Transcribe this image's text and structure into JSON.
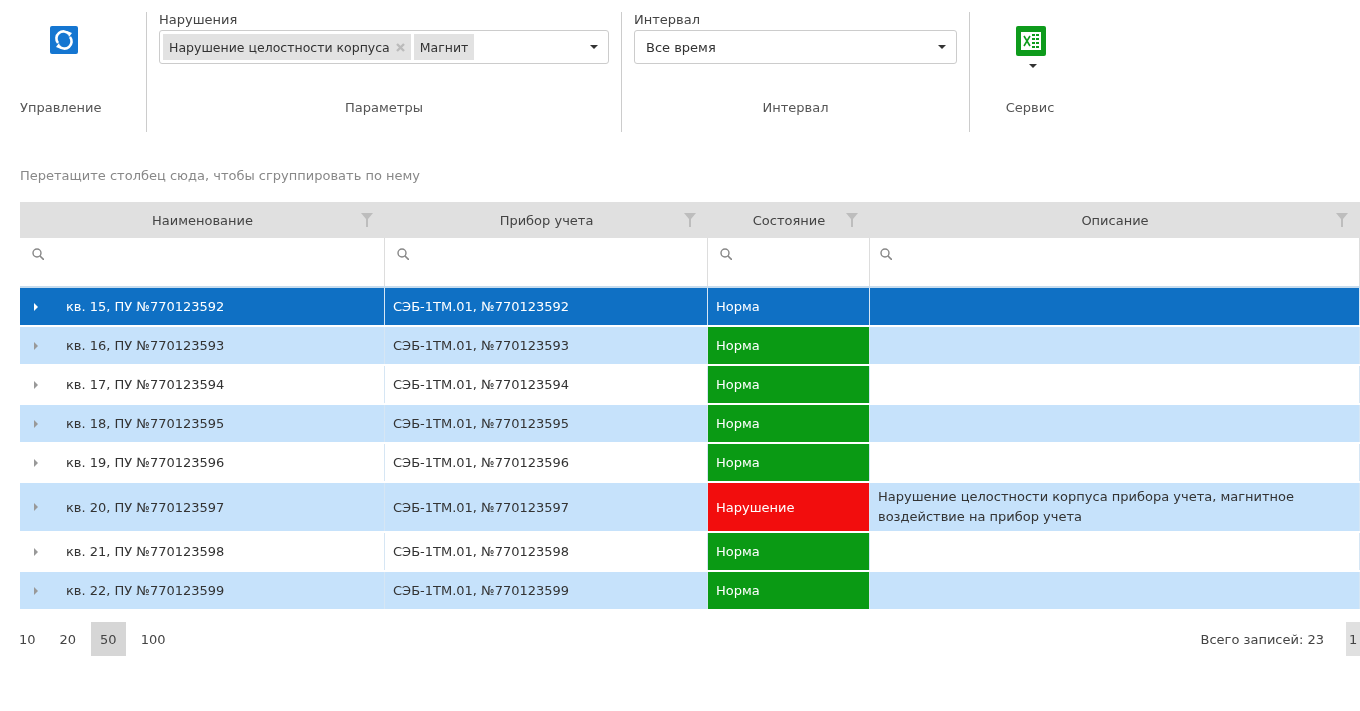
{
  "toolbar": {
    "groups": [
      {
        "kind": "refresh",
        "caption": "Управление"
      },
      {
        "kind": "multiselect",
        "caption": "Параметры",
        "label": "Нарушения",
        "tags": [
          {
            "text": "Нарушение целостности корпуса",
            "removable": true
          },
          {
            "text": "Магнит",
            "removable": false
          }
        ]
      },
      {
        "kind": "select",
        "caption": "Интервал",
        "label": "Интервал",
        "value": "Все время"
      },
      {
        "kind": "export",
        "caption": "Сервис"
      }
    ]
  },
  "group_panel": {
    "hint": "Перетащите столбец сюда, чтобы сгруппировать по нему"
  },
  "table": {
    "columns": [
      "Наименование",
      "Прибор учета",
      "Состояние",
      "Описание"
    ],
    "rows": [
      {
        "name": "кв. 15, ПУ №770123592",
        "device": "СЭБ-1ТМ.01, №770123592",
        "state": "Норма",
        "kind": "ok",
        "description": "",
        "selected": true
      },
      {
        "name": "кв. 16, ПУ №770123593",
        "device": "СЭБ-1ТМ.01, №770123593",
        "state": "Норма",
        "kind": "ok",
        "description": "",
        "selected": false
      },
      {
        "name": "кв. 17, ПУ №770123594",
        "device": "СЭБ-1ТМ.01, №770123594",
        "state": "Норма",
        "kind": "ok",
        "description": "",
        "selected": false
      },
      {
        "name": "кв. 18, ПУ №770123595",
        "device": "СЭБ-1ТМ.01, №770123595",
        "state": "Норма",
        "kind": "ok",
        "description": "",
        "selected": false
      },
      {
        "name": "кв. 19, ПУ №770123596",
        "device": "СЭБ-1ТМ.01, №770123596",
        "state": "Норма",
        "kind": "ok",
        "description": "",
        "selected": false
      },
      {
        "name": "кв. 20, ПУ №770123597",
        "device": "СЭБ-1ТМ.01, №770123597",
        "state": "Нарушение",
        "kind": "violation",
        "description": "Нарушение целостности корпуса прибора учета, магнитное воздействие на прибор учета",
        "selected": false
      },
      {
        "name": "кв. 21, ПУ №770123598",
        "device": "СЭБ-1ТМ.01, №770123598",
        "state": "Норма",
        "kind": "ok",
        "description": "",
        "selected": false
      },
      {
        "name": "кв. 22, ПУ №770123599",
        "device": "СЭБ-1ТМ.01, №770123599",
        "state": "Норма",
        "kind": "ok",
        "description": "",
        "selected": false
      }
    ]
  },
  "pager": {
    "page_sizes": [
      {
        "label": "10",
        "selected": false
      },
      {
        "label": "20",
        "selected": false
      },
      {
        "label": "50",
        "selected": true
      },
      {
        "label": "100",
        "selected": false
      }
    ],
    "total": "Всего записей: 23",
    "pages": [
      {
        "label": "1",
        "selected": true
      }
    ]
  }
}
